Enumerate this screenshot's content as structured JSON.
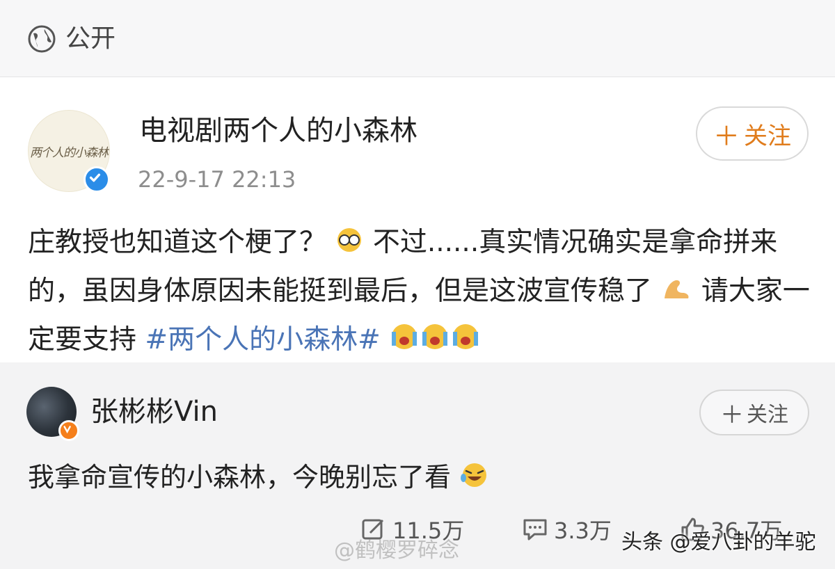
{
  "visibility": {
    "label": "公开",
    "icon": "globe-icon"
  },
  "post": {
    "author": "电视剧两个人的小森林",
    "avatar_text": "两个人的小森林",
    "timestamp": "22-9-17 22:13",
    "follow_label": "关注",
    "text_part1": "庄教授也知道这个梗了？",
    "text_part2": "不过......真实情况确实是拿命拼来的，虽因身体原因未能挺到最后，但是这波宣传稳了",
    "text_part3": "请大家一定要支持",
    "hashtag": "#两个人的小森林#"
  },
  "repost": {
    "author": "张彬彬Vin",
    "follow_label": "关注",
    "text": "我拿命宣传的小森林，今晚别忘了看"
  },
  "actions": {
    "repost_count": "11.5万",
    "comment_count": "3.3万",
    "like_count": "36.7万"
  },
  "watermark": "@鹤樱罗碎念",
  "source_mark": "头条 @爱八卦的羊驼",
  "colors": {
    "accent_orange": "#e07c1c",
    "hashtag_blue": "#4a74b6",
    "verified_blue": "#2b8de8"
  }
}
